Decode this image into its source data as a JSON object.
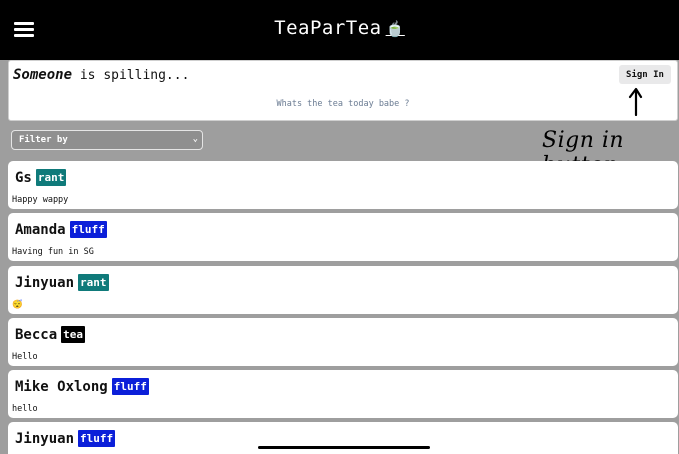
{
  "header": {
    "title": "TeaParTea",
    "logo_glyph": "🍵",
    "background": "#000000"
  },
  "composer": {
    "author_name": "Someone",
    "author_suffix": " is spilling...",
    "sign_in_label": "Sign In",
    "prompt_placeholder": "Whats the tea today babe ?"
  },
  "annotation": {
    "text": "Sign in button"
  },
  "filter": {
    "label": "Filter by"
  },
  "posts": [
    {
      "author": "Gs",
      "tag": "rant",
      "body": "Happy wappy"
    },
    {
      "author": "Amanda",
      "tag": "fluff",
      "body": "Having fun in SG"
    },
    {
      "author": "Jinyuan",
      "tag": "rant",
      "body": "😴"
    },
    {
      "author": "Becca",
      "tag": "tea",
      "body": "Hello"
    },
    {
      "author": "Mike Oxlong",
      "tag": "fluff",
      "body": "hello"
    },
    {
      "author": "Jinyuan",
      "tag": "fluff",
      "body": ""
    }
  ],
  "colors": {
    "rant": "#0f7a7a",
    "fluff": "#0b1fd9",
    "tea": "#000000",
    "page_background": "#9e9e9e"
  }
}
